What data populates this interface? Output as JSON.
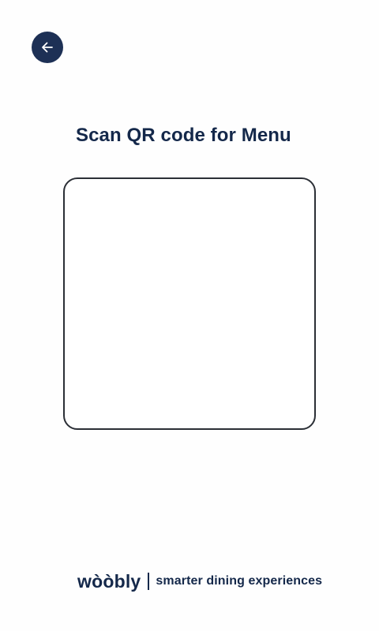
{
  "header": {
    "back_icon": "arrow-left-icon",
    "back_button_color": "#1d3055"
  },
  "main": {
    "title": "Scan QR code for Menu",
    "title_color": "#14284a"
  },
  "footer": {
    "logo_text": "wòòbly",
    "tagline": "smarter dining experiences"
  }
}
